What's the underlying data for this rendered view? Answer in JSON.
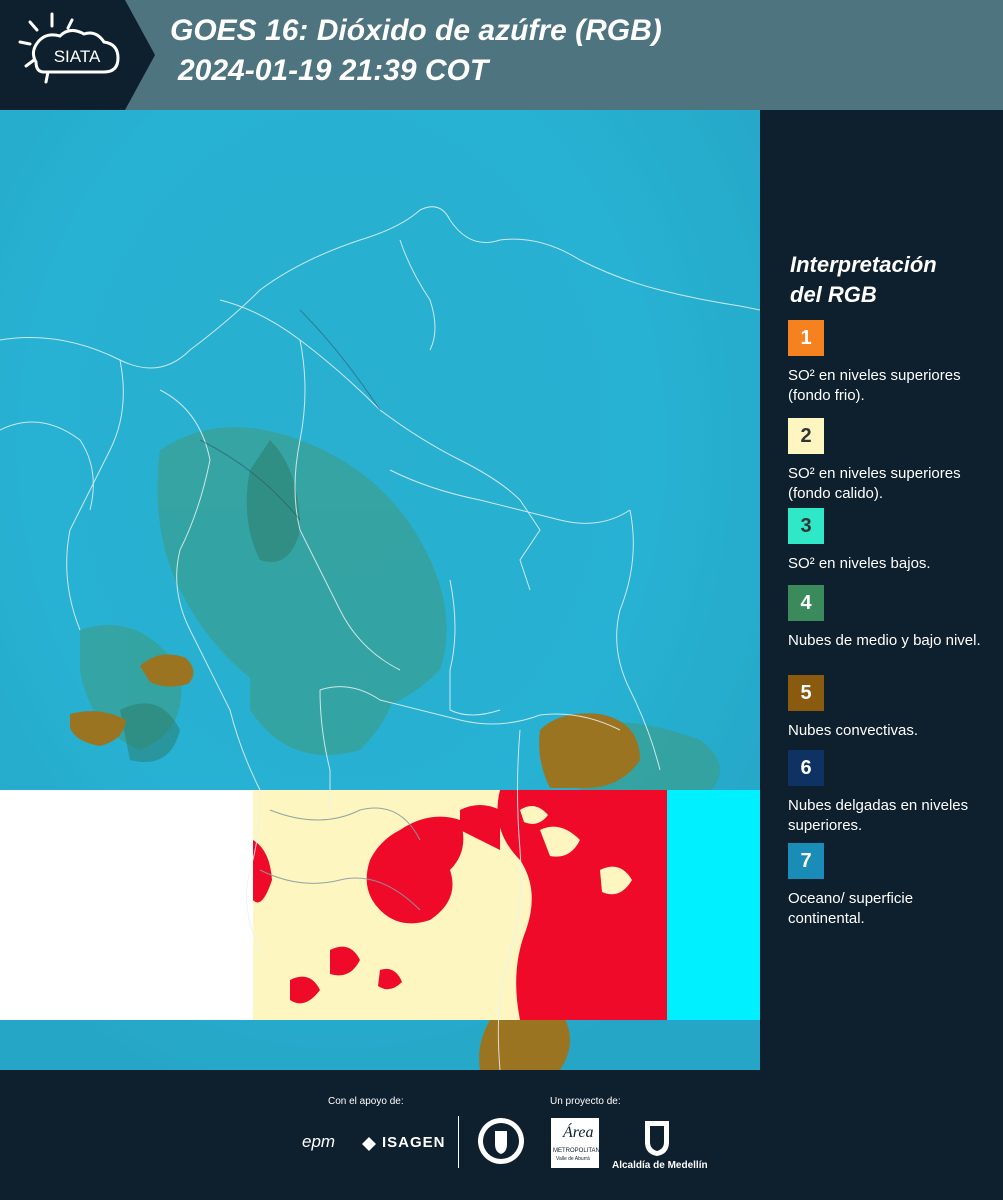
{
  "header": {
    "brand": "SIATA",
    "title_line1": "GOES 16: Dióxido de azúfre (RGB)",
    "title_line2": "2024-01-19 21:39 COT"
  },
  "legend": {
    "title_line1": "Interpretación",
    "title_line2": "del RGB",
    "items": [
      {
        "number": "1",
        "color": "#f5821f",
        "text": "SO² en niveles superiores (fondo frio)."
      },
      {
        "number": "2",
        "color": "#fdf6c0",
        "text": "SO² en niveles superiores (fondo calido)."
      },
      {
        "number": "3",
        "color": "#2ee8c8",
        "text": "SO² en niveles bajos."
      },
      {
        "number": "4",
        "color": "#3a8a5c",
        "text": "Nubes de medio y bajo nivel."
      },
      {
        "number": "5",
        "color": "#8a5a0e",
        "text": "Nubes convectivas."
      },
      {
        "number": "6",
        "color": "#0e3264",
        "text": "Nubes delgadas en niveles superiores."
      },
      {
        "number": "7",
        "color": "#1a8cb8",
        "text": "Oceano/ superficie continental."
      }
    ]
  },
  "footer": {
    "support_label": "Con el apoyo de:",
    "support_logos": [
      "epm",
      "ISAGEN"
    ],
    "project_label": "Un proyecto de:",
    "area_logo_text": "Área",
    "area_logo_sub": "METROPOLITANA",
    "area_logo_sub2": "Valle de Aburrá",
    "alcaldia_label": "Alcaldía de Medellín"
  },
  "colors": {
    "header_bg": "#4e7480",
    "header_dark": "#0e1f2d",
    "footer_bg": "#0e1f2d",
    "map_background": "#2ab6d6",
    "so2_hot": "#fdf6c0",
    "so2_red": "#f00a2a",
    "cyan_band": "#00f0ff"
  }
}
